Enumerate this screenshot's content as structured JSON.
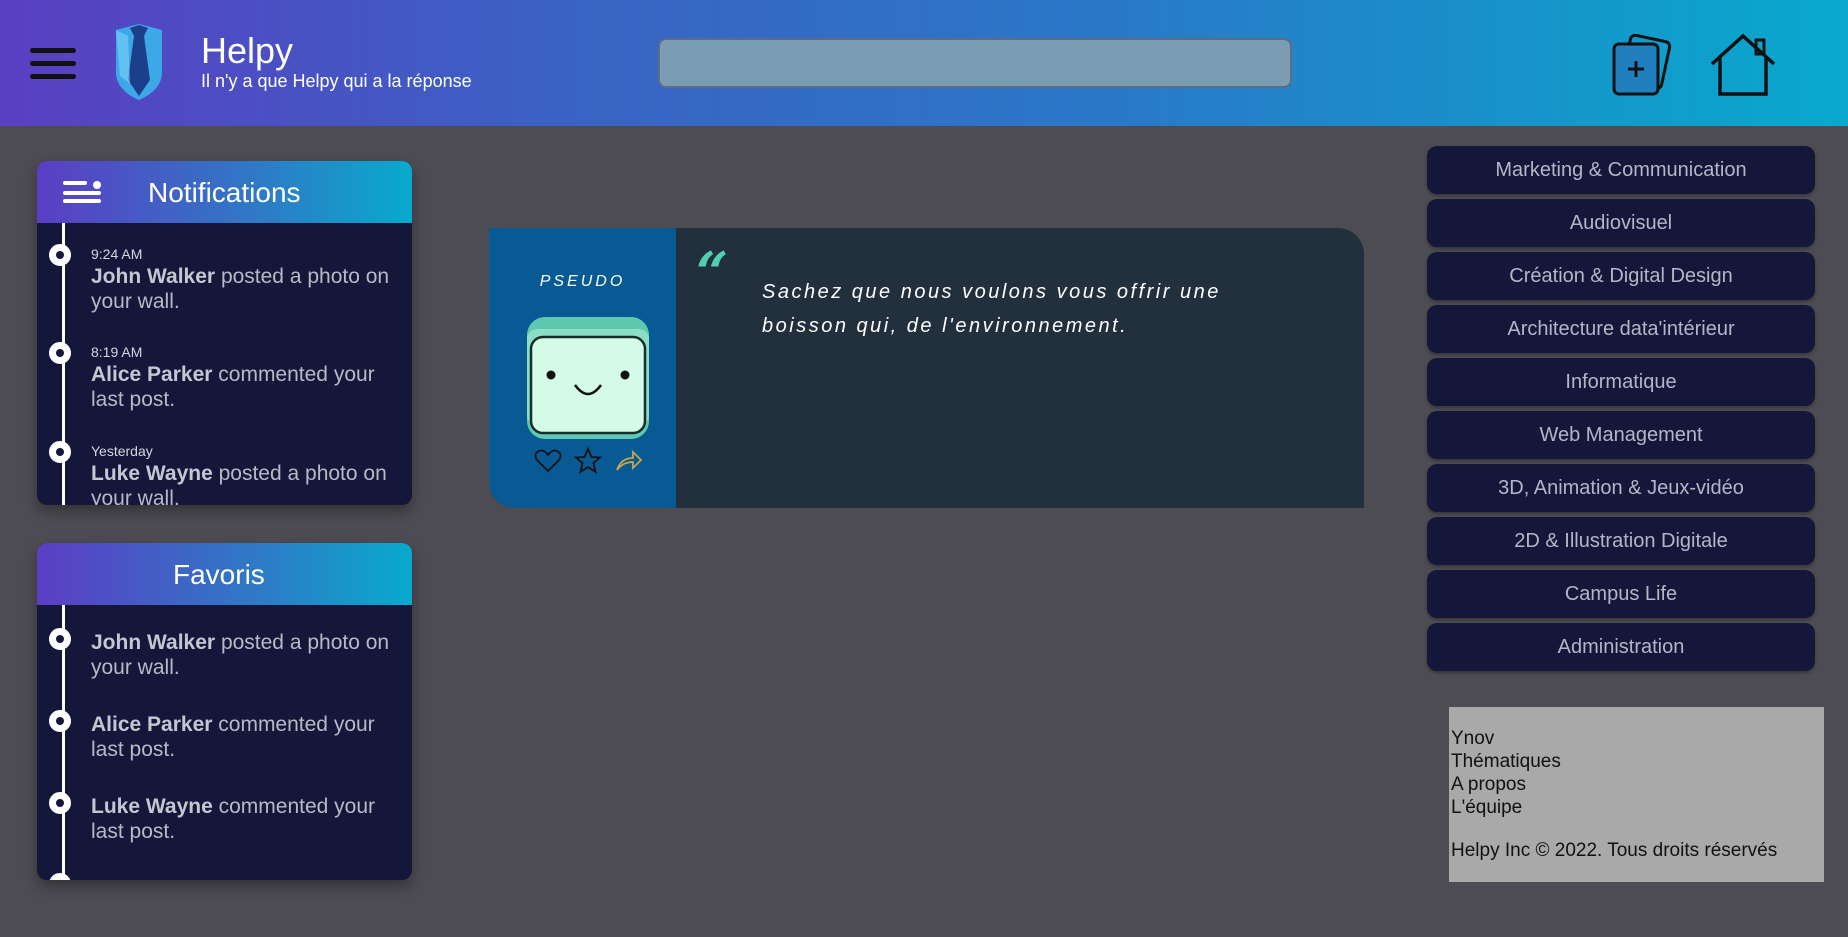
{
  "header": {
    "title": "Helpy",
    "subtitle": "Il n'y a que Helpy qui a la réponse",
    "search_value": "",
    "menu_icon": "hamburger-menu-icon",
    "logo_icon": "tie-shield-logo",
    "add_icon": "add-card-icon",
    "home_icon": "home-icon"
  },
  "notifications": {
    "title": "Notifications",
    "items": [
      {
        "time": "9:24 AM",
        "name": "John Walker",
        "action": "posted a photo on your wall."
      },
      {
        "time": "8:19 AM",
        "name": "Alice Parker",
        "action": "commented your last post."
      },
      {
        "time": "Yesterday",
        "name": "Luke Wayne",
        "action": "posted a photo on your wall."
      }
    ]
  },
  "favoris": {
    "title": "Favoris",
    "items": [
      {
        "name": "John Walker",
        "action": "posted a photo on your wall."
      },
      {
        "name": "Alice Parker",
        "action": "commented your last post."
      },
      {
        "name": "Luke Wayne",
        "action": "commented your last post."
      }
    ]
  },
  "post": {
    "pseudo": "PSEUDO",
    "quote_mark": "“",
    "text": "Sachez que nous voulons vous offrir une boisson qui, de l'environnement.",
    "actions": [
      "heart-icon",
      "star-icon",
      "share-icon"
    ]
  },
  "categories": [
    "Marketing & Communication",
    "Audiovisuel",
    "Création & Digital Design",
    "Architecture data'intérieur",
    "Informatique",
    "Web Management",
    "3D, Animation & Jeux-vidéo",
    "2D & Illustration Digitale",
    "Campus Life",
    "Administration"
  ],
  "footer": {
    "links": [
      "Ynov",
      "Thématiques",
      "A propos",
      "L'équipe"
    ],
    "copyright": "Helpy Inc © 2022. Tous droits réservés"
  },
  "colors": {
    "background": "#4d4c52",
    "panel": "#15173a",
    "accent_start": "#5a3fc2",
    "accent_end": "#08a9cd",
    "post_left": "#075a93",
    "post_body": "#222f3c"
  }
}
